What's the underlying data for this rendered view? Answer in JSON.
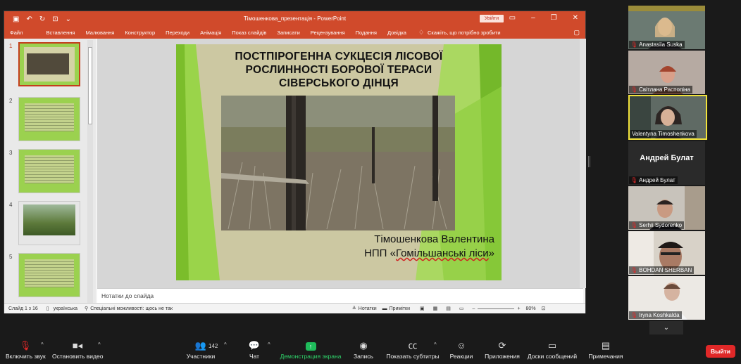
{
  "ppt": {
    "doc_title": "Тімошенкова_презентація - PowerPoint",
    "signin_label": "Увійти",
    "ribbon_tabs": [
      "Файл",
      "Вставлення",
      "Малювання",
      "Конструктор",
      "Переходи",
      "Анімація",
      "Показ слайдів",
      "Записати",
      "Рецензування",
      "Подання",
      "Довідка"
    ],
    "tell_me": "Скажіть, що потрібно зробити",
    "thumb_numbers": [
      "1",
      "2",
      "3",
      "4",
      "5"
    ],
    "notes_placeholder": "Нотатки до слайда",
    "status": {
      "slide_of": "Слайд 1 з 16",
      "language": "українська",
      "accessibility": "Спеціальні можливості: щось не так",
      "notes_btn": "Нотатки",
      "comments_btn": "Примітки",
      "zoom": "80%"
    }
  },
  "slide": {
    "title": "ПОСТПІРОГЕННА СУКЦЕСІЯ ЛІСОВОЇ РОСЛИННОСТІ БОРОВОЇ ТЕРАСИ СІВЕРСЬКОГО ДІНЦЯ",
    "author": "Тімошенкова Валентина",
    "org_prefix": "НПП «",
    "org_name": "Гомільшанські ліси",
    "org_suffix": "»"
  },
  "participants": [
    {
      "name": "Anastasiia Suska",
      "muted": true
    },
    {
      "name": "Світлана Распопіна",
      "muted": true
    },
    {
      "name": "Valentyna Timoshenkova",
      "muted": false
    },
    {
      "name": "Андрей Булат",
      "muted": true,
      "big_label": "Андрей Булат"
    },
    {
      "name": "Serhii Sydorenko",
      "muted": true
    },
    {
      "name": "BOHDAN SHERBAN",
      "muted": true
    },
    {
      "name": "Iryna Koshkalda",
      "muted": true
    }
  ],
  "toolbar": {
    "unmute": "Включить звук",
    "video": "Остановить видео",
    "participants": "Участники",
    "participants_count": "142",
    "chat": "Чат",
    "share": "Демонстрация экрана",
    "record": "Запись",
    "captions": "Показать субтитры",
    "reactions": "Реакции",
    "apps": "Приложения",
    "whiteboards": "Доски сообщений",
    "notes": "Примечания",
    "leave": "Выйти"
  }
}
